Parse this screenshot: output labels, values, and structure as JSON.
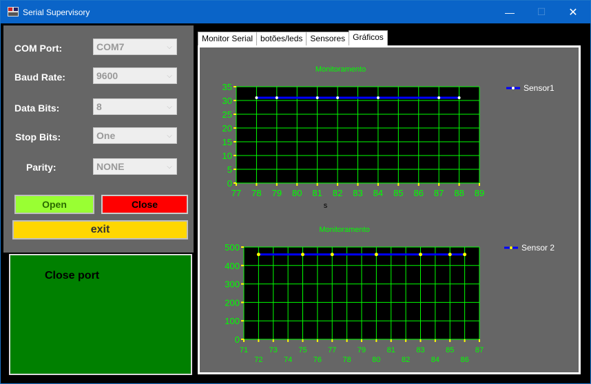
{
  "window": {
    "title": "Serial Supervisory",
    "min_glyph": "—",
    "max_glyph": "☐",
    "close_glyph": "✕"
  },
  "form": {
    "com_port": {
      "label": "COM Port:",
      "value": "COM7"
    },
    "baud_rate": {
      "label": "Baud Rate:",
      "value": "9600"
    },
    "data_bits": {
      "label": "Data Bits:",
      "value": "8"
    },
    "stop_bits": {
      "label": "Stop Bits:",
      "value": "One"
    },
    "parity": {
      "label": "Parity:",
      "value": "NONE"
    }
  },
  "buttons": {
    "open": "Open",
    "close": "Close",
    "exit": "exit"
  },
  "status": {
    "text": "Close port"
  },
  "tabs": [
    "Monitor Serial",
    "botões/leds",
    "Sensores",
    "Gráficos"
  ],
  "active_tab": 3,
  "colors": {
    "grid": "#00ff00",
    "series": "#0000ff",
    "marker1": "#ffffff",
    "marker2": "#ffff00",
    "title": "#00ff00",
    "plot_bg": "#000000"
  },
  "chart_data": [
    {
      "type": "line",
      "title": "Monitoramento",
      "xlabel": "s",
      "ylabel": "",
      "xlim": [
        77,
        89
      ],
      "ylim": [
        0,
        35
      ],
      "x_ticks": [
        77,
        78,
        79,
        80,
        81,
        82,
        83,
        84,
        85,
        86,
        87,
        88,
        89
      ],
      "y_ticks": [
        0,
        5,
        10,
        15,
        20,
        25,
        30,
        35
      ],
      "legend": "top-right",
      "grid": true,
      "series": [
        {
          "name": "Sensor1",
          "x": [
            78,
            79,
            81,
            82,
            84,
            87,
            88
          ],
          "y": [
            31,
            31,
            31,
            31,
            31,
            31,
            31
          ]
        }
      ]
    },
    {
      "type": "line",
      "title": "Monitoramento",
      "xlabel": "",
      "ylabel": "",
      "xlim": [
        71,
        87
      ],
      "ylim": [
        0,
        500
      ],
      "x_ticks": [
        71,
        72,
        73,
        74,
        75,
        76,
        77,
        78,
        79,
        80,
        81,
        82,
        83,
        84,
        85,
        86,
        87
      ],
      "y_ticks": [
        0,
        100,
        200,
        300,
        400,
        500
      ],
      "legend": "top-right",
      "grid": true,
      "series": [
        {
          "name": "Sensor 2",
          "x": [
            72,
            75,
            77,
            80,
            83,
            85,
            86
          ],
          "y": [
            460,
            460,
            460,
            460,
            460,
            460,
            460
          ]
        }
      ]
    }
  ]
}
